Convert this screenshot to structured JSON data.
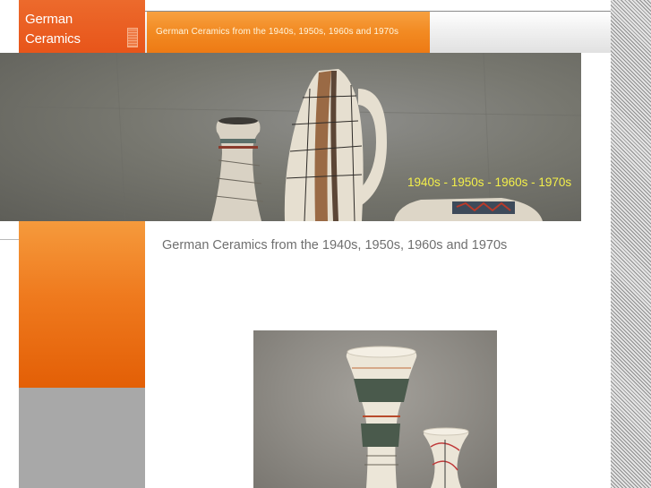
{
  "logo": {
    "line1": "German",
    "line2": "Ceramics"
  },
  "nav": {
    "tab_label": "German Ceramics from the 1940s, 1950s, 1960s and 1970s"
  },
  "hero": {
    "caption": "1940s - 1950s - 1960s - 1970s",
    "caption_color": "#f3ef4a"
  },
  "main": {
    "heading": "German Ceramics from the 1940s, 1950s, 1960s and 1970s"
  },
  "colors": {
    "accent_orange": "#ef7a1e",
    "logo_orange": "#e8551a",
    "sidebar_gray": "#a8a8a8",
    "heading_gray": "#6f6f6f"
  }
}
